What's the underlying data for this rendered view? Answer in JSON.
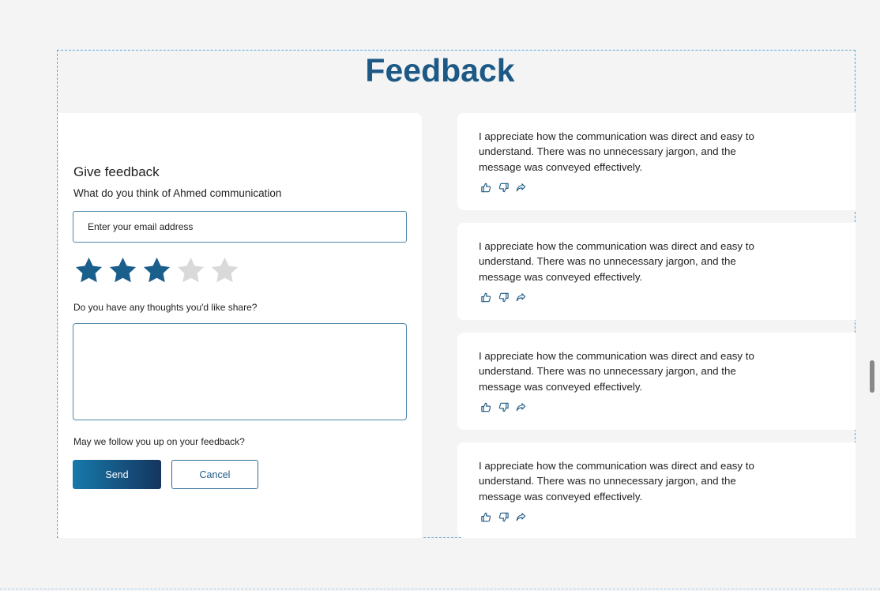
{
  "page": {
    "title": "Feedback"
  },
  "form": {
    "heading": "Give feedback",
    "question": "What do you think of Ahmed communication",
    "email_placeholder": "Enter your email address",
    "rating": {
      "value": 3,
      "max": 5,
      "filled_color": "#1a5e8c",
      "empty_color": "#d9d9d9"
    },
    "thoughts_label": "Do you have any thoughts you'd like share?",
    "thoughts_value": "",
    "followup_label": "May we follow you up on your feedback?",
    "send_label": "Send",
    "cancel_label": "Cancel"
  },
  "reviews": [
    {
      "text": "I appreciate how the communication was direct and easy to understand. There was no unnecessary jargon, and the message was conveyed effectively."
    },
    {
      "text": "I appreciate how the communication was direct and easy to understand. There was no unnecessary jargon, and the message was conveyed effectively."
    },
    {
      "text": "I appreciate how the communication was direct and easy to understand. There was no unnecessary jargon, and the message was conveyed effectively."
    },
    {
      "text": "I appreciate how the communication was direct and easy to understand. There was no unnecessary jargon, and the message was conveyed effectively."
    }
  ],
  "icons": {
    "like": "thumbs-up-icon",
    "dislike": "thumbs-down-icon",
    "share": "share-icon",
    "star": "star-icon"
  },
  "colors": {
    "accent": "#1c5a85",
    "border": "#4f87a8"
  }
}
